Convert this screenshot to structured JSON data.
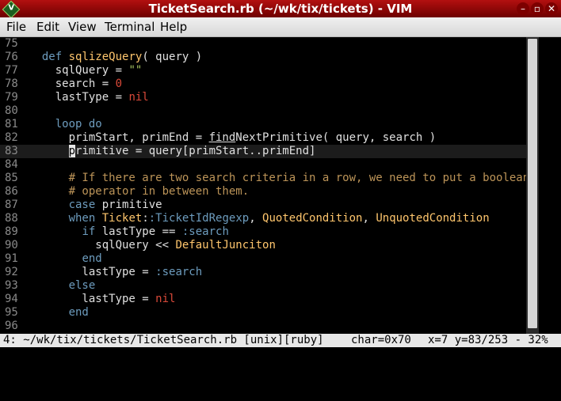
{
  "window": {
    "title": "TicketSearch.rb (~/wk/tix/tickets) - VIM",
    "icon": "vim-icon",
    "buttons": [
      "minimize",
      "maximize",
      "close"
    ]
  },
  "menu": [
    "File",
    "Edit",
    "View",
    "Terminal",
    "Help"
  ],
  "colors": {
    "keyword": "#6d9cbe",
    "function": "#ffc66d",
    "string": "#a5c261",
    "number": "#da4939",
    "comment": "#bc9458",
    "titlebar": "#b31010"
  },
  "editor": {
    "lines": [
      {
        "n": "75",
        "code": ""
      },
      {
        "n": "76",
        "code": "  def sqlizeQuery( query )"
      },
      {
        "n": "77",
        "code": "    sqlQuery = \"\""
      },
      {
        "n": "78",
        "code": "    search = 0"
      },
      {
        "n": "79",
        "code": "    lastType = nil"
      },
      {
        "n": "80",
        "code": ""
      },
      {
        "n": "81",
        "code": "    loop do"
      },
      {
        "n": "82",
        "code": "      primStart, primEnd = findNextPrimitive( query, search )"
      },
      {
        "n": "83",
        "code": "      primitive = query[primStart..primEnd]"
      },
      {
        "n": "84",
        "code": ""
      },
      {
        "n": "85",
        "code": "      # If there are two search criteria in a row, we need to put a boolean"
      },
      {
        "n": "86",
        "code": "      # operator in between them."
      },
      {
        "n": "87",
        "code": "      case primitive"
      },
      {
        "n": "88",
        "code": "      when Ticket::TicketIdRegexp, QuotedCondition, UnquotedCondition"
      },
      {
        "n": "89",
        "code": "        if lastType == :search"
      },
      {
        "n": "90",
        "code": "          sqlQuery << DefaultJunciton"
      },
      {
        "n": "91",
        "code": "        end"
      },
      {
        "n": "92",
        "code": "        lastType = :search"
      },
      {
        "n": "93",
        "code": "      else"
      },
      {
        "n": "94",
        "code": "        lastType = nil"
      },
      {
        "n": "95",
        "code": "      end"
      },
      {
        "n": "96",
        "code": ""
      }
    ],
    "cursor_line": "83"
  },
  "status": {
    "file": "4: ~/wk/tix/tickets/TicketSearch.rb [unix][ruby]",
    "char": "char=0x70",
    "pos": "x=7 y=83/253 - 32%"
  }
}
